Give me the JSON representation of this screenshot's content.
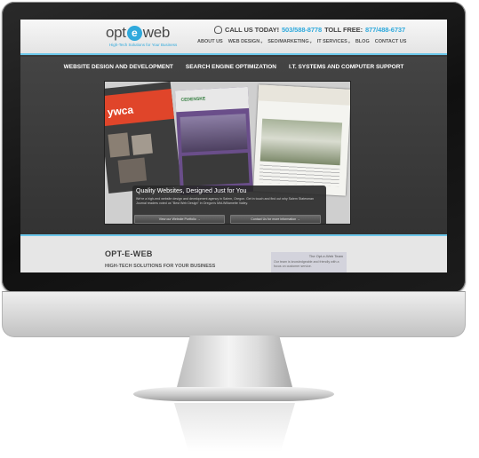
{
  "header": {
    "logo_pre": "opt",
    "logo_mid": "e",
    "logo_post": "web",
    "tagline": "High-Tech Solutions for Your Business",
    "call_label": "CALL US TODAY!",
    "phone_local": "503/588-8778",
    "toll_label": "TOLL FREE:",
    "phone_toll": "877/488-6737",
    "nav": [
      "ABOUT US",
      "WEB DESIGN",
      "SEO/MARKETING",
      "IT SERVICES",
      "BLOG",
      "CONTACT US"
    ]
  },
  "subnav": [
    "WEBSITE DESIGN AND DEVELOPMENT",
    "SEARCH ENGINE OPTIMIZATION",
    "I.T. SYSTEMS AND COMPUTER SUPPORT"
  ],
  "hero": {
    "shot1_name": "ywca",
    "shot2_logo": "CEDENSKE",
    "caption_title": "Quality Websites, Designed Just for You",
    "caption_body": "We're a high-end website design and development agency in Salem, Oregon. Get in touch and find out why Salem Statesman Journal readers voted us \"Best Web Design\" in Oregon's Mid-Willamette Valley.",
    "btn_portfolio": "View our Website Portfolio →",
    "btn_contact": "Contact Us for more information →"
  },
  "content": {
    "title": "OPT-E-WEB",
    "subtitle": "HIGH-TECH SOLUTIONS FOR YOUR BUSINESS",
    "team_title": "The Opt-e-Web Team",
    "team_text": "Our team is knowledgeable and friendly with a focus on customer service."
  },
  "colors": {
    "accent": "#2fa9dc",
    "dark_band": "#3a3a3a",
    "light_band": "#e6e6e6"
  }
}
